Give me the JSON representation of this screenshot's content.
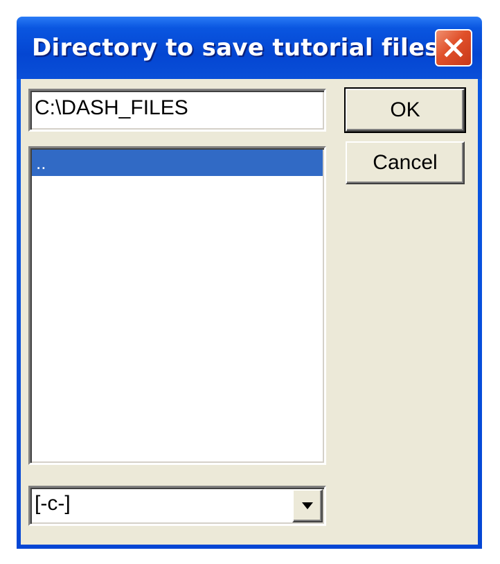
{
  "window": {
    "title": "Directory to save tutorial files"
  },
  "path_field": {
    "value": "C:\\DASH_FILES"
  },
  "directory_list": {
    "items": [
      {
        "label": "..",
        "selected": true
      }
    ]
  },
  "drive_select": {
    "selected": "[-c-]"
  },
  "buttons": {
    "ok_label": "OK",
    "cancel_label": "Cancel"
  },
  "icons": {
    "close": "close-icon",
    "dropdown": "chevron-down-icon"
  },
  "colors": {
    "titlebar": "#0a56e0",
    "selection": "#316ac5",
    "close_button": "#e0502a",
    "dialog_face": "#ece9d8"
  }
}
